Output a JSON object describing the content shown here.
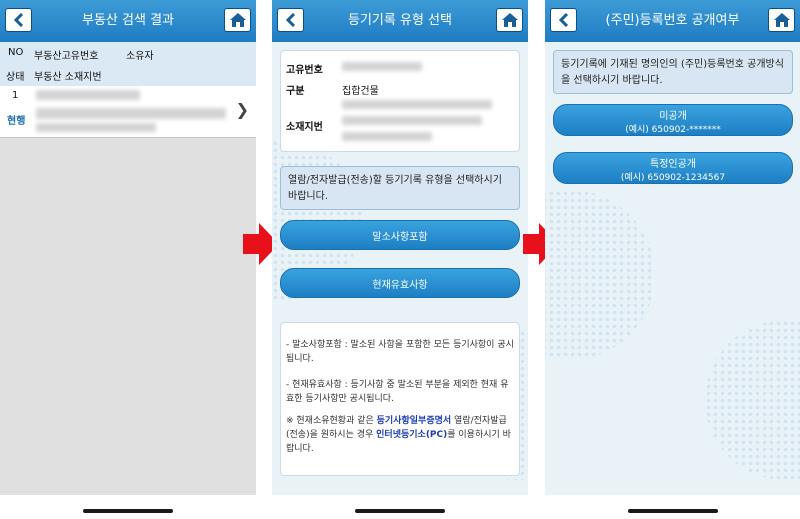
{
  "screen1": {
    "title": "부동산 검색 결과",
    "header": {
      "no_label": "NO",
      "id_label": "부동산고유번호",
      "owner_label": "소유자",
      "status_label": "상태",
      "address_label": "부동산 소재지번"
    },
    "result": {
      "no": "1",
      "status": "현행"
    }
  },
  "screen2": {
    "title": "등기기록 유형 선택",
    "info_rows": {
      "id_label": "고유번호",
      "type_label": "구분",
      "type_value": "집합건물",
      "address_label": "소재지번"
    },
    "instruction": "열람/전자발급(전송)할 등기기록 유형을 선택하시기 바랍니다.",
    "buttons": {
      "btn1": "말소사항포함",
      "btn2": "현재유효사항"
    },
    "notes": {
      "n1": "- 말소사항포함 : 말소된 사항을 포함한 모든 등기사항이 공시됩니다.",
      "n2": "- 현재유효사항 : 등기사항 중 말소된 부분을 제외한 현재 유효한 등기사항만 공시됩니다.",
      "n3_a": "※ 현재소유현황과 같은 ",
      "n3_b": "등기사항일부증명서",
      "n3_c": " 열람/전자발급(전송)을 원하시는 경우 ",
      "n3_d": "인터넷등기소(PC)",
      "n3_e": "를 이용하시기 바랍니다."
    }
  },
  "screen3": {
    "title": "(주민)등록번호 공개여부",
    "instruction": "등기기록에 기재된 명의인의 (주민)등록번호 공개방식을 선택하시기 바랍니다.",
    "option1": {
      "label": "미공개",
      "example": "(예시) 650902-*******"
    },
    "option2": {
      "label": "특정인공개",
      "example": "(예시) 650902-1234567"
    }
  },
  "colors": {
    "header_blue": "#1f7cc3",
    "button_blue": "#2a8fd3",
    "arrow_red": "#e8101a",
    "link_blue": "#1e3db5"
  },
  "icons": {
    "back": "chevron-left-icon",
    "home": "home-icon",
    "next": "chevron-right-icon",
    "arrow": "right-arrow-icon"
  }
}
